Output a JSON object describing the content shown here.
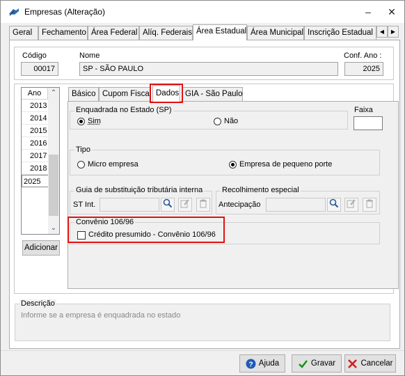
{
  "window": {
    "title": "Empresas (Alteração)",
    "minimize_glyph": "–",
    "close_glyph": "✕"
  },
  "tabs": [
    {
      "label": "Geral"
    },
    {
      "label": "Fechamento"
    },
    {
      "label": "Área Federal"
    },
    {
      "label": "Alíq. Federais"
    },
    {
      "label": "Área Estadual",
      "active": true
    },
    {
      "label": "Área Municipal"
    },
    {
      "label": "Inscrição Estadual S"
    }
  ],
  "header": {
    "codigo_label": "Código",
    "codigo_value": "00017",
    "nome_label": "Nome",
    "nome_value": "SP - SÃO PAULO",
    "conf_ano_label": "Conf. Ano :",
    "conf_ano_value": "2025"
  },
  "years": {
    "header": "Ano",
    "items": [
      "2013",
      "2014",
      "2015",
      "2016",
      "2017",
      "2018",
      "2025"
    ],
    "selected": "2025",
    "add_button_label": "Adicionar"
  },
  "inner_tabs": [
    {
      "label": "Básico"
    },
    {
      "label": "Cupom Fiscal"
    },
    {
      "label": "Dados",
      "active": true
    },
    {
      "label": "GIA - São Paulo"
    }
  ],
  "enquadrada": {
    "title": "Enquadrada no Estado (SP)",
    "options": [
      {
        "label": "Sim",
        "checked": true
      },
      {
        "label": "Não",
        "checked": false
      }
    ],
    "faixa_label": "Faixa",
    "faixa_value": ""
  },
  "tipo": {
    "title": "Tipo",
    "options": [
      {
        "label": "Micro empresa",
        "checked": false
      },
      {
        "label": "Empresa de pequeno porte",
        "checked": true
      }
    ]
  },
  "guia": {
    "title": "Guia de substituição tributária interna",
    "field_label": "ST Int.",
    "field_value": ""
  },
  "recolhimento": {
    "title": "Recolhimento especial",
    "field_label": "Antecipação",
    "field_value": ""
  },
  "convenio": {
    "title": "Convênio 106/96",
    "checkbox_label": "Crédito presumido - Convênio 106/96",
    "checked": false
  },
  "descricao": {
    "title": "Descrição",
    "text": "Informe se a empresa é enquadrada no estado"
  },
  "buttons": {
    "ajuda": "Ajuda",
    "gravar": "Gravar",
    "cancelar": "Cancelar"
  },
  "colors": {
    "highlight_red": "#e01010",
    "gravar_green": "#1a8f1a",
    "cancelar_red": "#d01c1c",
    "ajuda_blue": "#1e5bb8"
  }
}
